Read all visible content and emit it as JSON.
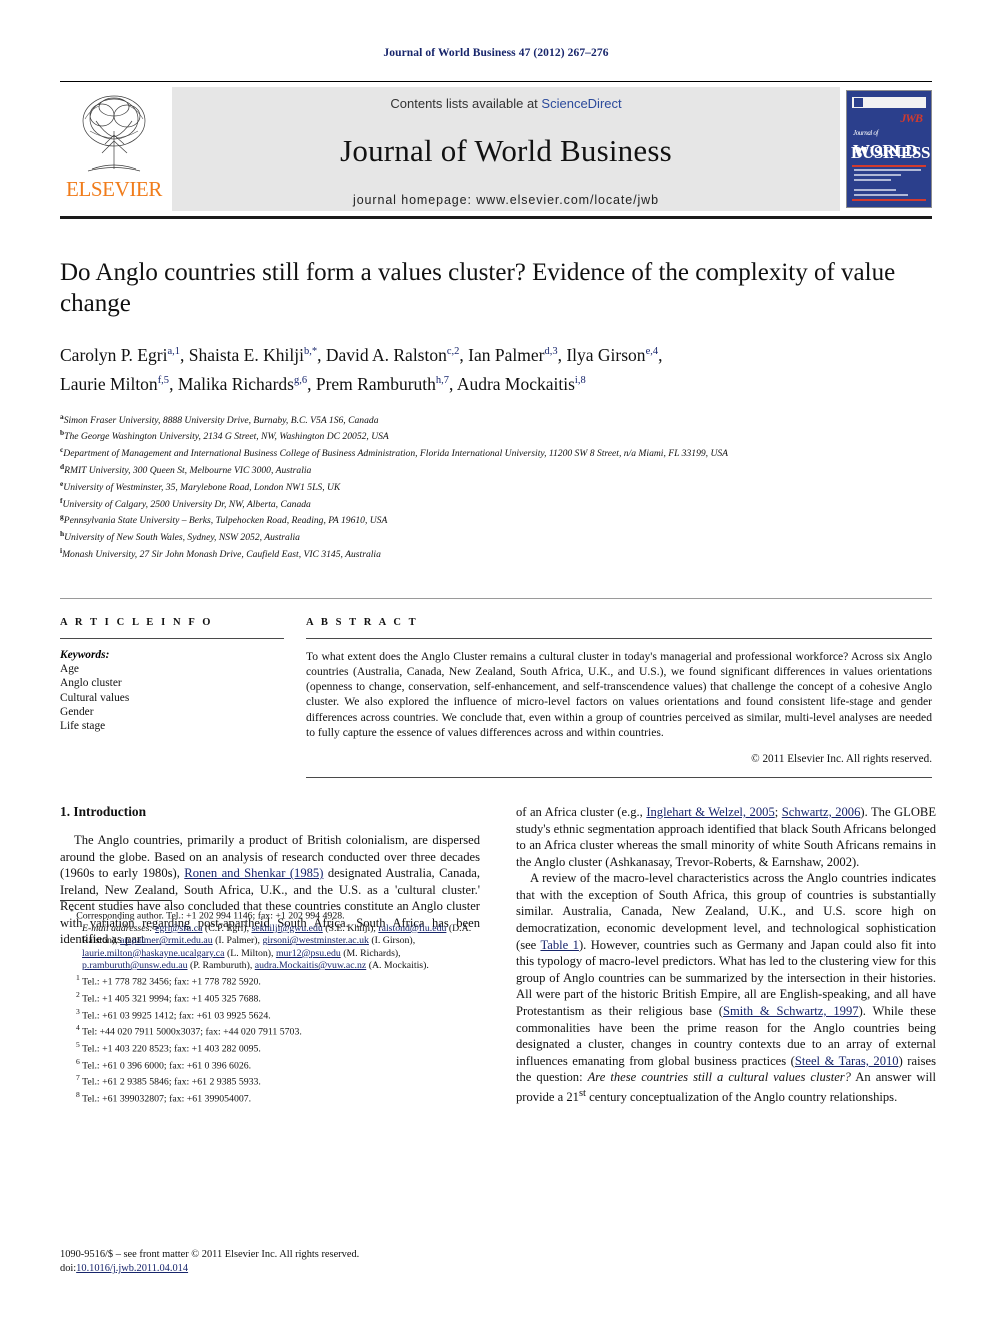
{
  "running_head": "Journal of World Business 47 (2012) 267–276",
  "masthead": {
    "contents_prefix": "Contents lists available at",
    "contents_link": "ScienceDirect",
    "journal_name": "Journal of World Business",
    "homepage_label": "journal homepage: www.elsevier.com/locate/jwb",
    "publisher_wordmark": "ELSEVIER",
    "cover": {
      "jwb_mark": "JWB",
      "line1_small": "Journal of",
      "line1": "WORLD",
      "line2": "BUSINESS"
    }
  },
  "article": {
    "title": "Do Anglo countries still form a values cluster? Evidence of the complexity of value change",
    "authors_line1": "Carolyn P. Egri a,1, Shaista E. Khilji b,*, David A. Ralston c,2, Ian Palmer d,3, Ilya Girson e,4,",
    "authors_line2": "Laurie Milton f,5, Malika Richards g,6, Prem Ramburuth h,7, Audra Mockaitis i,8",
    "affiliations": [
      {
        "marker": "a",
        "text": "Simon Fraser University, 8888 University Drive, Burnaby, B.C. V5A 1S6, Canada"
      },
      {
        "marker": "b",
        "text": "The George Washington University, 2134 G Street, NW, Washington DC 20052, USA"
      },
      {
        "marker": "c",
        "text": "Department of Management and International Business College of Business Administration, Florida International University, 11200 SW 8 Street, n/a Miami, FL 33199, USA"
      },
      {
        "marker": "d",
        "text": "RMIT University, 300 Queen St, Melbourne VIC 3000, Australia"
      },
      {
        "marker": "e",
        "text": "University of Westminster, 35, Marylebone Road, London NW1 5LS, UK"
      },
      {
        "marker": "f",
        "text": "University of Calgary, 2500 University Dr, NW, Alberta, Canada"
      },
      {
        "marker": "g",
        "text": "Pennsylvania State University – Berks, Tulpehocken Road, Reading, PA 19610, USA"
      },
      {
        "marker": "h",
        "text": "University of New South Wales, Sydney, NSW 2052, Australia"
      },
      {
        "marker": "i",
        "text": "Monash University, 27 Sir John Monash Drive, Caufield East, VIC 3145, Australia"
      }
    ]
  },
  "article_info": {
    "heading": "A R T I C L E   I N F O",
    "keywords_label": "Keywords:",
    "keywords": [
      "Age",
      "Anglo cluster",
      "Cultural values",
      "Gender",
      "Life stage"
    ]
  },
  "abstract": {
    "heading": "A B S T R A C T",
    "text": "To what extent does the Anglo Cluster remains a cultural cluster in today's managerial and professional workforce? Across six Anglo countries (Australia, Canada, New Zealand, South Africa, U.K., and U.S.), we found significant differences in values orientations (openness to change, conservation, self-enhancement, and self-transcendence values) that challenge the concept of a cohesive Anglo cluster. We also explored the influence of micro-level factors on values orientations and found consistent life-stage and gender differences across countries. We conclude that, even within a group of countries perceived as similar, multi-level analyses are needed to fully capture the essence of values differences across and within countries.",
    "copyright": "© 2011 Elsevier Inc. All rights reserved."
  },
  "intro": {
    "heading": "1. Introduction",
    "left_p1_a": "The Anglo countries, primarily a product of British colonialism, are dispersed around the globe. Based on an analysis of research conducted over three decades (1960s to early 1980s), ",
    "left_p1_cite": "Ronen and Shenkar (1985)",
    "left_p1_b": " designated Australia, Canada, Ireland, New Zealand, South Africa, U.K., and the U.S. as a 'cultural cluster.' Recent studies have also concluded that these countries constitute an Anglo cluster with variation regarding post-apartheid South Africa. South Africa has been identified as part",
    "right_p1_a": "of an Africa cluster (e.g., ",
    "right_p1_cite1": "Inglehart & Welzel, 2005",
    "right_p1_b": "; ",
    "right_p1_cite2": "Schwartz, 2006",
    "right_p1_c": "). The GLOBE study's ethnic segmentation approach identified that black South Africans belonged to an Africa cluster whereas the small minority of white South Africans remains in the Anglo cluster (Ashkanasay, Trevor-Roberts, & Earnshaw, 2002).",
    "right_p2_a": "A review of the macro-level characteristics across the Anglo countries indicates that with the exception of South Africa, this group of countries is substantially similar. Australia, Canada, New Zealand, U.K., and U.S. score high on democratization, economic development level, and technological sophistication (see ",
    "right_p2_cite1": "Table 1",
    "right_p2_b": "). However, countries such as Germany and Japan could also fit into this typology of macro-level predictors. What has led to the clustering view for this group of Anglo countries can be summarized by the intersection in their histories. All were part of the historic British Empire, all are English-speaking, and all have Protestantism as their religious base (",
    "right_p2_cite2": "Smith & Schwartz, 1997",
    "right_p2_c": "). While these commonalities have been the prime reason for the Anglo countries being designated a cluster, changes in country contexts due to an array of external influences emanating from global business practices (",
    "right_p2_cite3": "Steel & Taras, 2010",
    "right_p2_d": ") raises the question: ",
    "right_p2_ital": "Are these countries still a cultural values cluster?",
    "right_p2_e": " An answer will provide a 21",
    "right_p2_sup": "st",
    "right_p2_f": " century conceptualization of the Anglo country relationships."
  },
  "footnotes": {
    "corresponding": "Corresponding author. Tel.: +1 202 994 1146; fax: +1 202 994 4928.",
    "email_label": "E-mail addresses:",
    "emails": [
      {
        "mail": "egri@sfu.ca",
        "who": " (C.P. Egri), "
      },
      {
        "mail": "sekhilji@gwu.edu",
        "who": " (S.E. Khilji), "
      },
      {
        "mail": "ralstond@fiu.edu",
        "who": " (D.A. Ralston), "
      },
      {
        "mail": "an.palmer@rmit.edu.au",
        "who": " (I. Palmer), "
      },
      {
        "mail": "girsoni@westminster.ac.uk",
        "who": " (I. Girson), "
      },
      {
        "mail": "laurie.milton@haskayne.ucalgary.ca",
        "who": " (L. Milton), "
      },
      {
        "mail": "mur12@psu.edu",
        "who": " (M. Richards), "
      },
      {
        "mail": "p.ramburuth@unsw.edu.au",
        "who": " (P. Ramburuth), "
      },
      {
        "mail": "audra.Mockaitis@vuw.ac.nz",
        "who": " (A. Mockaitis)."
      }
    ],
    "tels": [
      {
        "n": "1",
        "text": "Tel.: +1 778 782 3456; fax: +1 778 782 5920."
      },
      {
        "n": "2",
        "text": "Tel.: +1 405 321 9994; fax: +1 405 325 7688."
      },
      {
        "n": "3",
        "text": "Tel.: +61 03 9925 1412; fax: +61 03 9925 5624."
      },
      {
        "n": "4",
        "text": "Tel: +44 020 7911 5000x3037; fax: +44 020 7911 5703."
      },
      {
        "n": "5",
        "text": "Tel.: +1 403 220 8523; fax: +1 403 282 0095."
      },
      {
        "n": "6",
        "text": "Tel.: +61 0 396 6000; fax: +61 0 396 6026."
      },
      {
        "n": "7",
        "text": "Tel.: +61 2 9385 5846; fax: +61 2 9385 5933."
      },
      {
        "n": "8",
        "text": "Tel.: +61 399032807; fax: +61 399054007."
      }
    ]
  },
  "page_footer": {
    "line1": "1090-9516/$ – see front matter © 2011 Elsevier Inc. All rights reserved.",
    "doi_label": "doi:",
    "doi": "10.1016/j.jwb.2011.04.014"
  }
}
